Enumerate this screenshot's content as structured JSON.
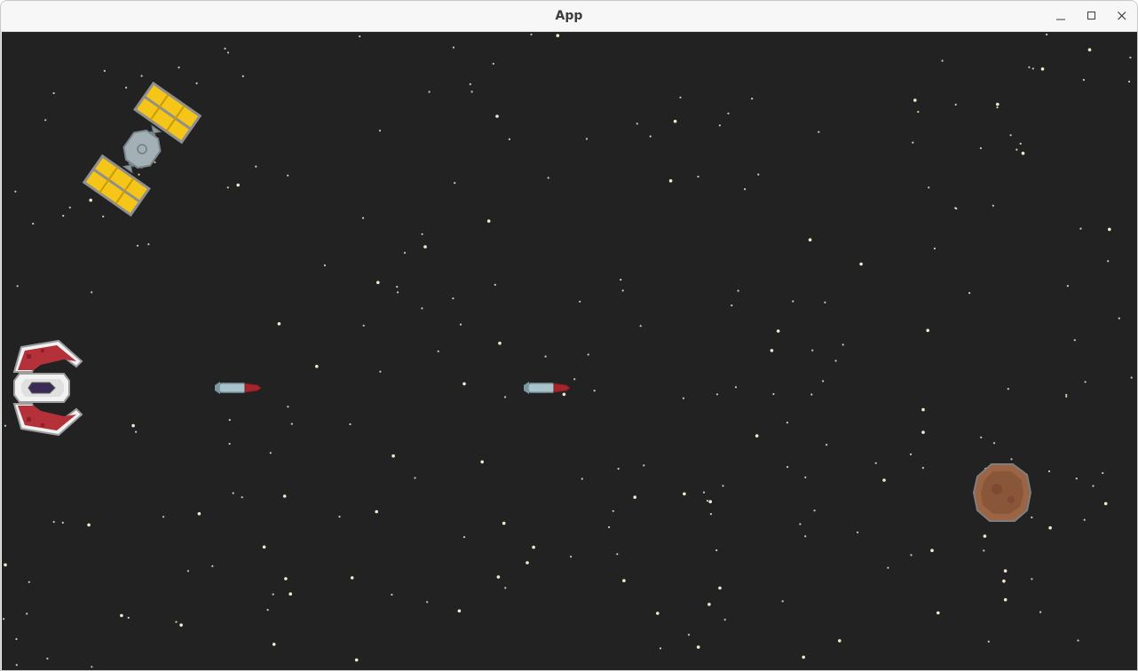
{
  "window": {
    "title": "App",
    "controls": [
      "minimize-icon",
      "maximize-icon",
      "close-icon"
    ]
  },
  "colors": {
    "background": "#222222",
    "star": "#fff6d8",
    "satellite_panel": "#f5c518",
    "satellite_body": "#9aa7ad",
    "player_red": "#b5313a",
    "player_white": "#f2f2f2",
    "player_cockpit": "#3b2a55",
    "missile_body": "#a9c3cc",
    "missile_tip": "#a4262c",
    "asteroid": "#9a6445"
  },
  "entities": [
    "player-ship",
    "missile",
    "missile",
    "satellite",
    "asteroid"
  ]
}
